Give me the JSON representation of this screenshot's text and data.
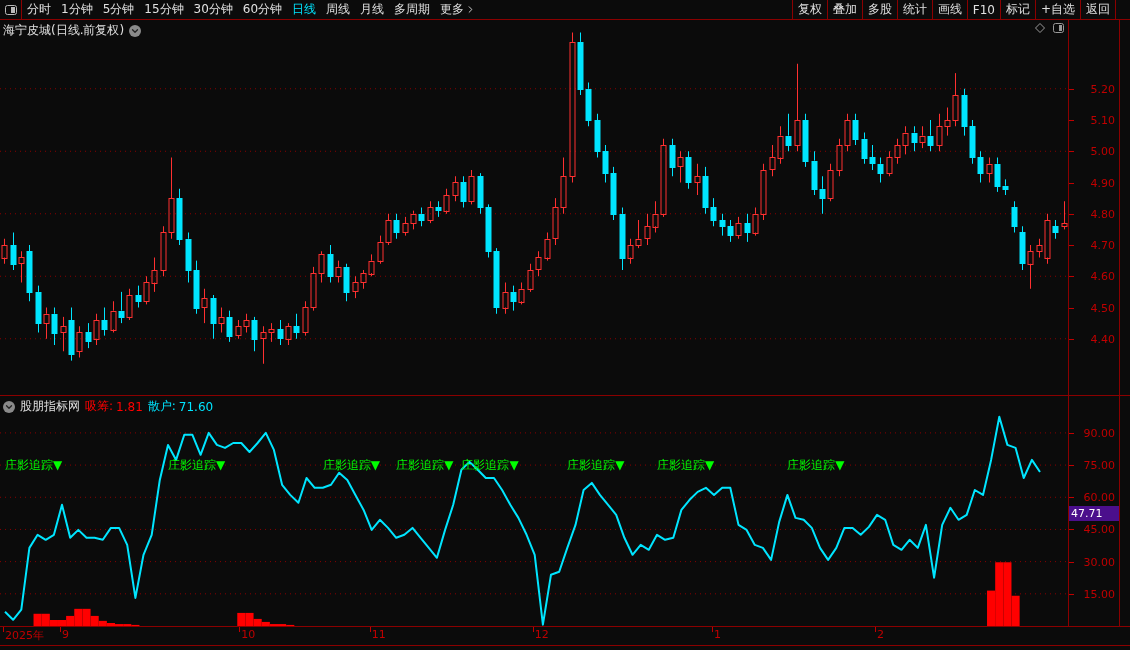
{
  "toolbar": {
    "periods": [
      {
        "label": "分时",
        "selected": false
      },
      {
        "label": "1分钟",
        "selected": false
      },
      {
        "label": "5分钟",
        "selected": false
      },
      {
        "label": "15分钟",
        "selected": false
      },
      {
        "label": "30分钟",
        "selected": false
      },
      {
        "label": "60分钟",
        "selected": false
      },
      {
        "label": "日线",
        "selected": true
      },
      {
        "label": "周线",
        "selected": false
      },
      {
        "label": "月线",
        "selected": false
      },
      {
        "label": "多周期",
        "selected": false
      },
      {
        "label": "更多",
        "selected": false
      }
    ],
    "buttons": [
      "复权",
      "叠加",
      "多股",
      "统计",
      "画线",
      "F10",
      "标记",
      "+自选",
      "返回"
    ]
  },
  "price_chart": {
    "title": "海宁皮城(日线.前复权)",
    "chart_data": {
      "type": "candlestick",
      "grid": true,
      "ylim": [
        4.22,
        5.42
      ],
      "yticks": [
        {
          "value": 5.2,
          "label": "5.20"
        },
        {
          "value": 5.1,
          "label": "5.10"
        },
        {
          "value": 5.0,
          "label": "5.00"
        },
        {
          "value": 4.9,
          "label": "4.90"
        },
        {
          "value": 4.8,
          "label": "4.80"
        },
        {
          "value": 4.7,
          "label": "4.70"
        },
        {
          "value": 4.6,
          "label": "4.60"
        },
        {
          "value": 4.5,
          "label": "4.50"
        },
        {
          "value": 4.4,
          "label": "4.40"
        }
      ],
      "categories": [
        null,
        null,
        null,
        null,
        null,
        null,
        null,
        null,
        null,
        null,
        null,
        null,
        null,
        null,
        null,
        null,
        null,
        null,
        null,
        null,
        null,
        null,
        null,
        null,
        null,
        null,
        null,
        null,
        null,
        null,
        null,
        null,
        null,
        null,
        null,
        null,
        null,
        null,
        null,
        null,
        null,
        null,
        null,
        null,
        null,
        null,
        null,
        null,
        null,
        null,
        null,
        null,
        null,
        null,
        null,
        null,
        null,
        null,
        null,
        null,
        null,
        null,
        null,
        null,
        null,
        null,
        null,
        null,
        null,
        null,
        null,
        null,
        null,
        null,
        null,
        null,
        null,
        null,
        null,
        null,
        null,
        null,
        null,
        null,
        null,
        null,
        null,
        null,
        null,
        null,
        null,
        null,
        null,
        null,
        null,
        null,
        null,
        null,
        null,
        null,
        null,
        null,
        null,
        null,
        null,
        null,
        null,
        null,
        null,
        null,
        null,
        null,
        null,
        null,
        null,
        null,
        null,
        null,
        null,
        null,
        null,
        null,
        null,
        null,
        null,
        null,
        null,
        null
      ],
      "ohlc": [
        [
          4.66,
          4.72,
          4.64,
          4.7
        ],
        [
          4.7,
          4.74,
          4.62,
          4.64
        ],
        [
          4.64,
          4.68,
          4.58,
          4.66
        ],
        [
          4.68,
          4.7,
          4.52,
          4.55
        ],
        [
          4.55,
          4.57,
          4.42,
          4.45
        ],
        [
          4.45,
          4.5,
          4.4,
          4.48
        ],
        [
          4.48,
          4.5,
          4.38,
          4.42
        ],
        [
          4.42,
          4.47,
          4.36,
          4.44
        ],
        [
          4.46,
          4.5,
          4.33,
          4.35
        ],
        [
          4.36,
          4.44,
          4.34,
          4.42
        ],
        [
          4.42,
          4.45,
          4.37,
          4.39
        ],
        [
          4.4,
          4.48,
          4.38,
          4.46
        ],
        [
          4.46,
          4.5,
          4.41,
          4.43
        ],
        [
          4.43,
          4.52,
          4.42,
          4.49
        ],
        [
          4.49,
          4.55,
          4.45,
          4.47
        ],
        [
          4.47,
          4.56,
          4.46,
          4.54
        ],
        [
          4.54,
          4.57,
          4.5,
          4.52
        ],
        [
          4.52,
          4.6,
          4.51,
          4.58
        ],
        [
          4.58,
          4.66,
          4.55,
          4.62
        ],
        [
          4.62,
          4.76,
          4.6,
          4.74
        ],
        [
          4.74,
          4.98,
          4.72,
          4.85
        ],
        [
          4.85,
          4.88,
          4.7,
          4.72
        ],
        [
          4.72,
          4.74,
          4.58,
          4.62
        ],
        [
          4.62,
          4.65,
          4.48,
          4.5
        ],
        [
          4.5,
          4.56,
          4.45,
          4.53
        ],
        [
          4.53,
          4.54,
          4.4,
          4.45
        ],
        [
          4.45,
          4.5,
          4.42,
          4.47
        ],
        [
          4.47,
          4.49,
          4.39,
          4.41
        ],
        [
          4.41,
          4.46,
          4.4,
          4.44
        ],
        [
          4.44,
          4.48,
          4.42,
          4.46
        ],
        [
          4.46,
          4.47,
          4.36,
          4.4
        ],
        [
          4.4,
          4.44,
          4.32,
          4.42
        ],
        [
          4.42,
          4.45,
          4.39,
          4.43
        ],
        [
          4.43,
          4.46,
          4.38,
          4.4
        ],
        [
          4.4,
          4.45,
          4.38,
          4.44
        ],
        [
          4.44,
          4.48,
          4.4,
          4.42
        ],
        [
          4.42,
          4.52,
          4.41,
          4.5
        ],
        [
          4.5,
          4.63,
          4.49,
          4.61
        ],
        [
          4.61,
          4.68,
          4.58,
          4.67
        ],
        [
          4.67,
          4.7,
          4.58,
          4.6
        ],
        [
          4.6,
          4.65,
          4.58,
          4.63
        ],
        [
          4.63,
          4.64,
          4.52,
          4.55
        ],
        [
          4.55,
          4.6,
          4.53,
          4.58
        ],
        [
          4.58,
          4.62,
          4.56,
          4.61
        ],
        [
          4.61,
          4.67,
          4.6,
          4.65
        ],
        [
          4.65,
          4.73,
          4.64,
          4.71
        ],
        [
          4.71,
          4.8,
          4.7,
          4.78
        ],
        [
          4.78,
          4.8,
          4.72,
          4.74
        ],
        [
          4.74,
          4.79,
          4.73,
          4.77
        ],
        [
          4.77,
          4.81,
          4.75,
          4.8
        ],
        [
          4.8,
          4.82,
          4.76,
          4.78
        ],
        [
          4.78,
          4.84,
          4.77,
          4.82
        ],
        [
          4.82,
          4.84,
          4.79,
          4.81
        ],
        [
          4.81,
          4.88,
          4.8,
          4.86
        ],
        [
          4.86,
          4.92,
          4.84,
          4.9
        ],
        [
          4.9,
          4.92,
          4.82,
          4.84
        ],
        [
          4.84,
          4.94,
          4.83,
          4.92
        ],
        [
          4.92,
          4.93,
          4.8,
          4.82
        ],
        [
          4.82,
          4.83,
          4.66,
          4.68
        ],
        [
          4.68,
          4.69,
          4.48,
          4.5
        ],
        [
          4.5,
          4.58,
          4.48,
          4.55
        ],
        [
          4.55,
          4.57,
          4.49,
          4.52
        ],
        [
          4.52,
          4.58,
          4.51,
          4.56
        ],
        [
          4.56,
          4.64,
          4.55,
          4.62
        ],
        [
          4.62,
          4.68,
          4.6,
          4.66
        ],
        [
          4.66,
          4.74,
          4.65,
          4.72
        ],
        [
          4.72,
          4.85,
          4.7,
          4.82
        ],
        [
          4.82,
          4.98,
          4.8,
          4.92
        ],
        [
          4.92,
          5.38,
          4.9,
          5.35
        ],
        [
          5.35,
          5.38,
          5.18,
          5.2
        ],
        [
          5.2,
          5.22,
          5.08,
          5.1
        ],
        [
          5.1,
          5.12,
          4.98,
          5.0
        ],
        [
          5.0,
          5.02,
          4.9,
          4.93
        ],
        [
          4.93,
          4.95,
          4.78,
          4.8
        ],
        [
          4.8,
          4.82,
          4.62,
          4.66
        ],
        [
          4.66,
          4.72,
          4.64,
          4.7
        ],
        [
          4.7,
          4.78,
          4.69,
          4.72
        ],
        [
          4.72,
          4.8,
          4.7,
          4.76
        ],
        [
          4.76,
          4.84,
          4.74,
          4.8
        ],
        [
          4.8,
          5.04,
          4.79,
          5.02
        ],
        [
          5.02,
          5.04,
          4.92,
          4.95
        ],
        [
          4.95,
          5.0,
          4.9,
          4.98
        ],
        [
          4.98,
          5.0,
          4.88,
          4.9
        ],
        [
          4.9,
          4.96,
          4.86,
          4.92
        ],
        [
          4.92,
          4.95,
          4.8,
          4.82
        ],
        [
          4.82,
          4.85,
          4.76,
          4.78
        ],
        [
          4.78,
          4.8,
          4.73,
          4.76
        ],
        [
          4.76,
          4.78,
          4.71,
          4.73
        ],
        [
          4.73,
          4.79,
          4.72,
          4.77
        ],
        [
          4.77,
          4.8,
          4.71,
          4.74
        ],
        [
          4.74,
          4.82,
          4.73,
          4.8
        ],
        [
          4.8,
          4.96,
          4.78,
          4.94
        ],
        [
          4.94,
          5.02,
          4.92,
          4.98
        ],
        [
          4.98,
          5.08,
          4.96,
          5.05
        ],
        [
          5.05,
          5.12,
          5.0,
          5.02
        ],
        [
          5.02,
          5.28,
          5.0,
          5.1
        ],
        [
          5.1,
          5.12,
          4.95,
          4.97
        ],
        [
          4.97,
          5.0,
          4.86,
          4.88
        ],
        [
          4.88,
          4.92,
          4.8,
          4.85
        ],
        [
          4.85,
          4.96,
          4.84,
          4.94
        ],
        [
          4.94,
          5.04,
          4.92,
          5.02
        ],
        [
          5.02,
          5.12,
          5.0,
          5.1
        ],
        [
          5.1,
          5.12,
          5.02,
          5.04
        ],
        [
          5.04,
          5.06,
          4.96,
          4.98
        ],
        [
          4.98,
          5.02,
          4.94,
          4.96
        ],
        [
          4.96,
          4.98,
          4.9,
          4.93
        ],
        [
          4.93,
          5.0,
          4.92,
          4.98
        ],
        [
          4.98,
          5.04,
          4.96,
          5.02
        ],
        [
          5.02,
          5.08,
          4.99,
          5.06
        ],
        [
          5.06,
          5.08,
          5.0,
          5.03
        ],
        [
          5.03,
          5.08,
          5.01,
          5.05
        ],
        [
          5.05,
          5.1,
          5.0,
          5.02
        ],
        [
          5.02,
          5.12,
          5.0,
          5.08
        ],
        [
          5.08,
          5.14,
          5.05,
          5.1
        ],
        [
          5.1,
          5.25,
          5.08,
          5.18
        ],
        [
          5.18,
          5.2,
          5.05,
          5.08
        ],
        [
          5.08,
          5.1,
          4.96,
          4.98
        ],
        [
          4.98,
          5.0,
          4.9,
          4.93
        ],
        [
          4.93,
          4.98,
          4.9,
          4.96
        ],
        [
          4.96,
          4.98,
          4.87,
          4.89
        ],
        [
          4.89,
          4.91,
          4.86,
          4.88
        ],
        [
          4.82,
          4.84,
          4.74,
          4.76
        ],
        [
          4.74,
          4.76,
          4.62,
          4.64
        ],
        [
          4.64,
          4.7,
          4.56,
          4.68
        ],
        [
          4.68,
          4.72,
          4.66,
          4.7
        ],
        [
          4.66,
          4.8,
          4.64,
          4.78
        ],
        [
          4.76,
          4.78,
          4.72,
          4.74
        ],
        [
          4.76,
          4.84,
          4.75,
          4.77
        ]
      ]
    }
  },
  "indicator": {
    "name": "股朋指标网",
    "readings": [
      "1.81",
      "71.60"
    ],
    "current_value": "47.71",
    "date_axis": [
      "2025年",
      "9",
      "10",
      "11",
      "12",
      "1",
      "2"
    ],
    "chart_data": {
      "type": "line",
      "grid": true,
      "ylim": [
        0,
        107.2
      ],
      "yticks": [
        {
          "value": 90,
          "label": "90.00"
        },
        {
          "value": 75,
          "label": "75.00"
        },
        {
          "value": 60,
          "label": "60.00"
        },
        {
          "value": 45,
          "label": "45.00"
        },
        {
          "value": 30,
          "label": "30.00"
        },
        {
          "value": 15,
          "label": "15.00"
        }
      ],
      "series": [
        {
          "name": "吸筹:",
          "type": "bar",
          "color": "#ff0000",
          "values": [
            null,
            null,
            null,
            null,
            5.7,
            5.7,
            2.8,
            2.8,
            4.7,
            8.0,
            8.0,
            4.7,
            2.4,
            1.4,
            0.9,
            0.9,
            0.5,
            null,
            null,
            null,
            null,
            null,
            null,
            null,
            null,
            null,
            null,
            null,
            null,
            6.1,
            6.1,
            3.3,
            1.9,
            0.9,
            0.9,
            0.5,
            null,
            null,
            null,
            null,
            null,
            null,
            null,
            null,
            null,
            null,
            null,
            null,
            null,
            null,
            null,
            null,
            null,
            null,
            null,
            null,
            null,
            null,
            null,
            null,
            null,
            null,
            null,
            null,
            null,
            null,
            null,
            null,
            null,
            null,
            null,
            null,
            null,
            null,
            null,
            null,
            null,
            null,
            null,
            null,
            null,
            null,
            null,
            null,
            null,
            null,
            null,
            null,
            null,
            null,
            null,
            null,
            null,
            null,
            null,
            null,
            null,
            null,
            null,
            null,
            null,
            null,
            null,
            null,
            null,
            null,
            null,
            null,
            null,
            null,
            null,
            null,
            null,
            null,
            null,
            null,
            null,
            null,
            null,
            null,
            null,
            16.5,
            29.7,
            29.7,
            14.1,
            null,
            null,
            null
          ]
        },
        {
          "name": "散户:",
          "type": "line",
          "color": "#00e5ff",
          "values": [
            6.6,
            2.9,
            7.6,
            36.4,
            42.5,
            40.2,
            42.5,
            56.5,
            41.1,
            44.8,
            41.1,
            41.1,
            40.2,
            45.7,
            45.7,
            37.8,
            13.1,
            33.2,
            42.5,
            68.1,
            84.4,
            77.4,
            89.1,
            89.1,
            79.8,
            90,
            84.4,
            83,
            85.3,
            85.3,
            81.1,
            85.3,
            90,
            82.1,
            65.8,
            61.1,
            57.4,
            69,
            64.4,
            64.4,
            65.8,
            71.4,
            68.1,
            61.1,
            54.1,
            44.8,
            49.5,
            45.7,
            41.1,
            42.5,
            45.7,
            41.1,
            36.4,
            31.8,
            44.8,
            56.5,
            72.8,
            76.5,
            72.8,
            69,
            69,
            63.4,
            56.5,
            50.4,
            42.5,
            33.2,
            0.6,
            23.9,
            25.3,
            36.4,
            47.1,
            63.4,
            66.7,
            61.1,
            56.5,
            51.8,
            41.1,
            33.2,
            37.8,
            35.5,
            42.5,
            40.2,
            41.1,
            54.1,
            58.8,
            62.5,
            64.4,
            61.1,
            64.4,
            64.4,
            47.1,
            44.8,
            37.8,
            36.4,
            30.8,
            48.5,
            61.1,
            50.4,
            49.5,
            45.7,
            36.4,
            30.8,
            36.4,
            45.7,
            45.7,
            42.5,
            46.2,
            51.8,
            49.5,
            37.8,
            35.5,
            40.2,
            36.4,
            47.1,
            22.5,
            47.1,
            55.1,
            49.5,
            51.8,
            63.4,
            61.1,
            77.4,
            97.5,
            84.4,
            83,
            69,
            77.4,
            71.8
          ]
        }
      ],
      "annotations": [
        "庄影追踪▼",
        "庄影追踪▼",
        "庄影追踪▼",
        "庄影追踪▼",
        "庄影追踪▼",
        "庄影追踪▼",
        "庄影追踪▼",
        "庄影追踪▼"
      ]
    }
  }
}
